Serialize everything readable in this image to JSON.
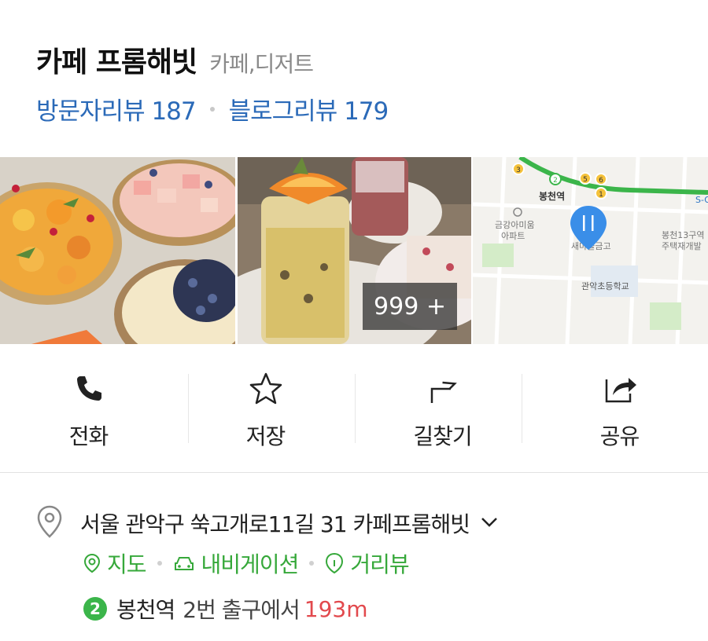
{
  "place": {
    "name": "카페 프롬해빗",
    "category": "카페,디저트"
  },
  "reviews": {
    "visitor": "방문자리뷰 187",
    "blog": "블로그리뷰 179"
  },
  "photos": {
    "items": [
      "dessert-tarts-photo",
      "drinks-photo",
      "map-thumbnail"
    ],
    "more_count": "999 +",
    "map": {
      "station_label": "봉천역",
      "apt_label": "금강아미움\n아파트",
      "apt_line1": "금강아미움",
      "apt_line2": "아파트",
      "school_label": "관악초등학교",
      "redev_line1": "봉천13구역",
      "redev_line2": "주택재개발",
      "bank_label": "새마을금고",
      "exit_labels": [
        "2",
        "3",
        "5",
        "6",
        "1"
      ],
      "edge_label": "S-OI"
    }
  },
  "actions": [
    {
      "label": "전화",
      "icon": "phone-icon"
    },
    {
      "label": "저장",
      "icon": "star-icon"
    },
    {
      "label": "길찾기",
      "icon": "directions-icon"
    },
    {
      "label": "공유",
      "icon": "share-icon"
    }
  ],
  "info": {
    "address": "서울 관악구 쑥고개로11길 31 카페프롬해빗",
    "links": {
      "map": "지도",
      "navigation": "내비게이션",
      "street_view": "거리뷰"
    },
    "subway": {
      "line": "2",
      "line_color": "#3bb54a",
      "station": "봉천역",
      "exit_text": "2번 출구에서",
      "distance": "193m"
    }
  },
  "colors": {
    "review_link": "#2b6ab8",
    "link_green": "#36a83a",
    "distance_red": "#e2494d"
  }
}
